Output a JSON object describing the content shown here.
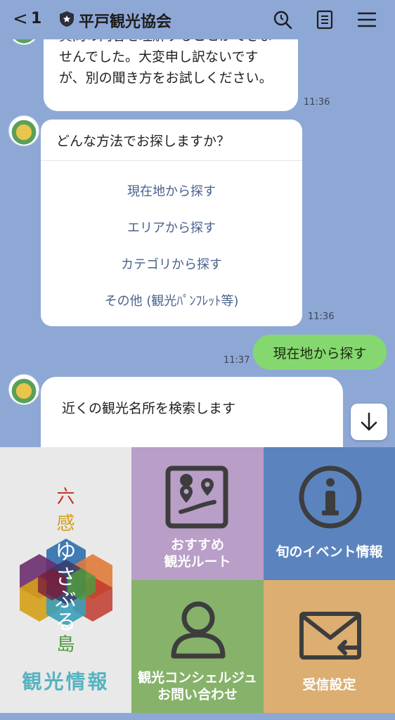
{
  "header": {
    "back_label": "<",
    "unread_count": "1",
    "title": "平戸観光協会",
    "icons": [
      "search-icon",
      "notes-icon",
      "menu-icon"
    ]
  },
  "chat": {
    "message1": {
      "text": "質問の内容を理解することができませんでした。大変申し訳ないですが、別の聞き方をお試しください。",
      "time": "11:36"
    },
    "card": {
      "question": "どんな方法でお探しますか？",
      "options": [
        "現在地から探す",
        "エリアから探す",
        "カテゴリから探す",
        "その他 (観光ﾊﾟﾝﾌﾚｯﾄ等)"
      ],
      "time": "11:36"
    },
    "user_message": {
      "text": "現在地から探す",
      "time": "11:37"
    },
    "message3": {
      "text": "近くの観光名所を検索します"
    },
    "scroll_down_icon": "arrow-down-icon"
  },
  "rich_menu": {
    "tour": {
      "vertical_chars": [
        "六",
        "感",
        "ゆ",
        "さ",
        "ぶ",
        "る",
        "島"
      ],
      "label": "観光情報"
    },
    "route": {
      "line1": "おすすめ",
      "line2": "観光ルート",
      "icon": "map-pin-icon"
    },
    "event": {
      "label": "旬のイベント情報",
      "icon": "info-icon"
    },
    "concierge": {
      "line1": "観光コンシェルジュ",
      "line2": "お問い合わせ",
      "icon": "person-icon"
    },
    "receive": {
      "label": "受信設定",
      "icon": "mail-icon"
    }
  },
  "colors": {
    "chat_bg": "#8ea8d6",
    "user_bubble": "#85d86f",
    "route_cell": "#b99ec8",
    "event_cell": "#5b84bf",
    "concierge_cell": "#86b26a",
    "receive_cell": "#dcae72"
  }
}
